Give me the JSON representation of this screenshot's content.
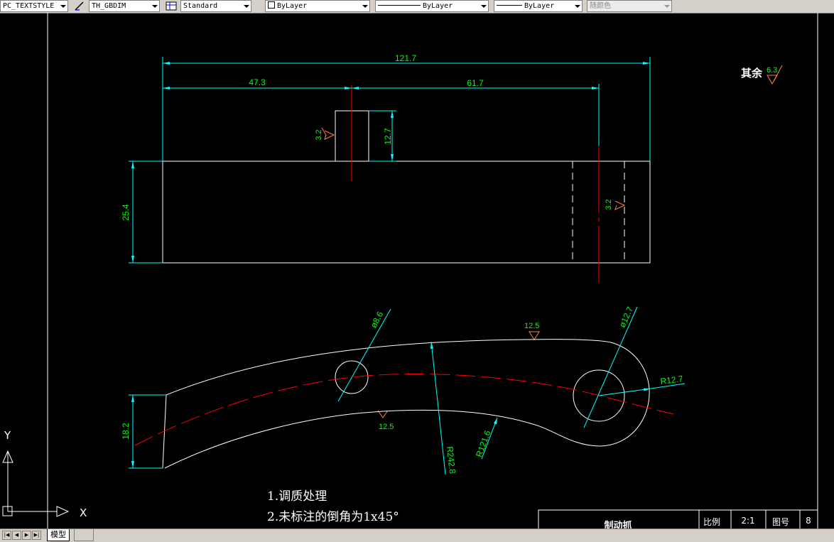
{
  "toolbar": {
    "text_style": "PC_TEXTSTYLE",
    "dim_style": "TH_GBDIM",
    "table_style": "Standard",
    "layer": "ByLayer",
    "linetype": "ByLayer",
    "lineweight": "ByLayer",
    "plot_style": "随颜色"
  },
  "drawing": {
    "dims": {
      "overall": "121.7",
      "left": "47.3",
      "right": "61.7",
      "boss_height": "12.7",
      "body_height": "25.4",
      "end_height": "18.2",
      "hole_small": "ø8.6",
      "hole_large": "ø12.7",
      "end_radius": "R12.7",
      "outer_radius": "R242.8",
      "inner_radius": "R121.6"
    },
    "roughness": {
      "rest_label": "其余",
      "rest_value": "6.3",
      "boss": "3.2",
      "hole": "3.2",
      "top_surface": "12.5",
      "bottom_surface": "12.5"
    },
    "notes": [
      "1.调质处理",
      "2.未标注的倒角为1x45°"
    ],
    "title_block": {
      "part_name": "制动抓",
      "scale_label": "比例",
      "scale_value": "2:1",
      "drawing_no_label": "图号",
      "drawing_no": "8"
    },
    "ucs": {
      "x": "X",
      "y": "Y"
    }
  },
  "tabs": {
    "model": "模型"
  },
  "colors": {
    "background": "#000000",
    "geometry": "#ffffff",
    "dimension": "#00ffff",
    "dim_text": "#00ff00",
    "centerline": "#ff0000",
    "roughness_symbol": "#ff8040"
  }
}
